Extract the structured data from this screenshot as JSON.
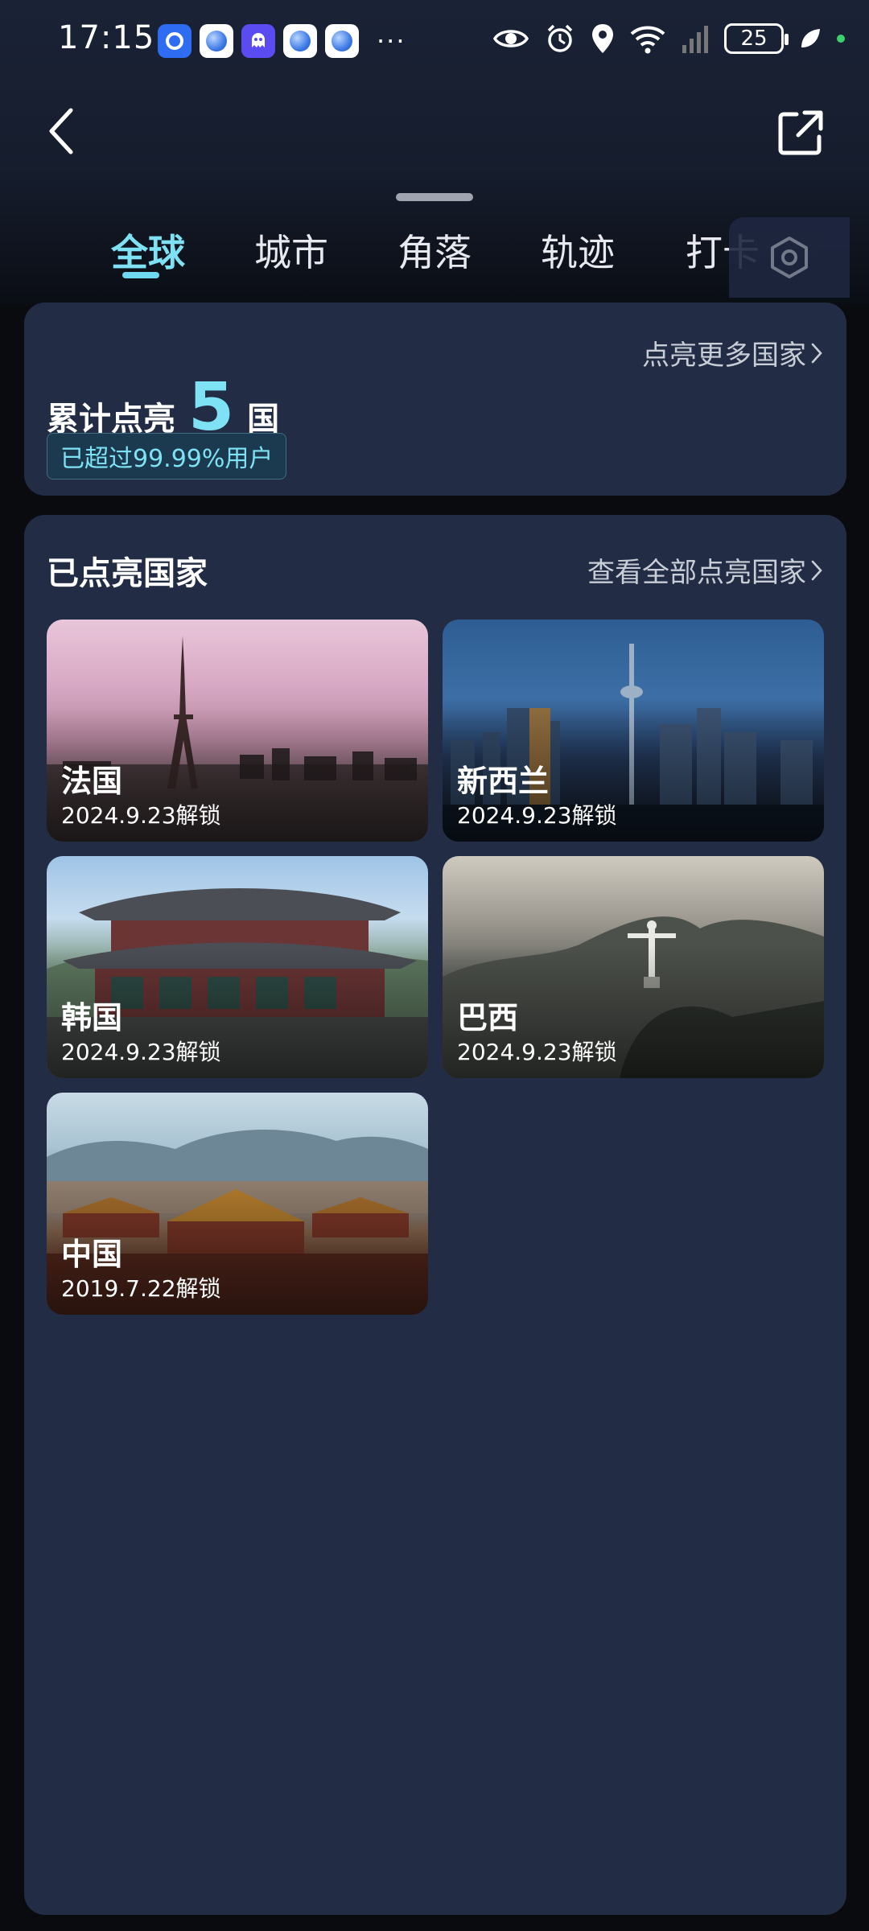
{
  "status_bar": {
    "time": "17:15",
    "more": "···",
    "battery": "25"
  },
  "tabs": [
    {
      "label": "全球",
      "active": true
    },
    {
      "label": "城市",
      "active": false
    },
    {
      "label": "角落",
      "active": false
    },
    {
      "label": "轨迹",
      "active": false
    },
    {
      "label": "打卡",
      "active": false
    }
  ],
  "summary": {
    "prefix": "累计点亮",
    "count": "5",
    "suffix": "国",
    "more_link": "点亮更多国家",
    "badge": "已超过99.99%用户"
  },
  "countries_section": {
    "title": "已点亮国家",
    "more_link": "查看全部点亮国家",
    "items": [
      {
        "name": "法国",
        "date": "2024.9.23解锁"
      },
      {
        "name": "新西兰",
        "date": "2024.9.23解锁"
      },
      {
        "name": "韩国",
        "date": "2024.9.23解锁"
      },
      {
        "name": "巴西",
        "date": "2024.9.23解锁"
      },
      {
        "name": "中国",
        "date": "2019.7.22解锁"
      }
    ]
  },
  "colors": {
    "accent": "#7ee2f4",
    "card": "#222d45",
    "background": "#0a0b0f"
  }
}
